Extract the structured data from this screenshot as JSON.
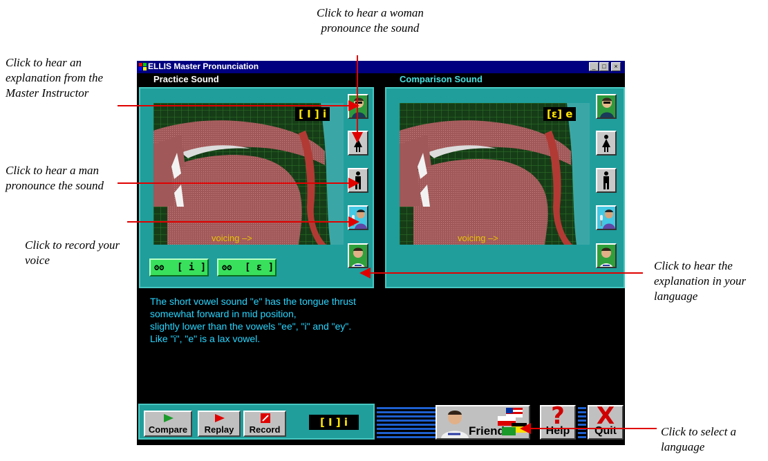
{
  "window": {
    "title": "ELLIS Master Pronunciation",
    "controls": [
      "_",
      "□",
      "×"
    ]
  },
  "practice": {
    "header": "Practice Sound",
    "phoneme": "[ I ]  i",
    "voicing": "voicing –>"
  },
  "comparison": {
    "header": "Comparison Sound",
    "phoneme": "[ε] e",
    "voicing": "voicing –>"
  },
  "compare_buttons": [
    {
      "label": "[ i ]"
    },
    {
      "label": "[ ε ]"
    }
  ],
  "side_buttons": [
    "instructor-icon",
    "woman-icon",
    "man-icon",
    "record-voice-icon",
    "native-language-icon"
  ],
  "explanation": {
    "lines": [
      "The short vowel sound \"e\" has the tongue thrust",
      "somewhat forward in mid position,",
      "slightly lower than the vowels \"ee\", \"i\" and \"ey\".",
      "Like \"i\", \"e\" is a lax vowel."
    ]
  },
  "toolbar": {
    "compare_label": "Compare",
    "replay_label": "Replay",
    "record_label": "Record",
    "current_sound": "[ I ]  i",
    "friend_label": "Friend",
    "help_label": "Help",
    "quit_label": "Quit"
  },
  "callouts": {
    "woman": [
      "Click to hear a woman",
      "pronounce the sound"
    ],
    "instructor": [
      "Click to hear an",
      "explanation from the",
      "Master Instructor"
    ],
    "man": [
      "Click to hear a man",
      "pronounce the sound"
    ],
    "record": [
      "Click to record your",
      "voice"
    ],
    "language_expl": [
      "Click to hear the",
      "explanation in your",
      "language"
    ],
    "select_language": [
      "Click to select a",
      "language"
    ]
  },
  "colors": {
    "panel": "#1f9e9c",
    "explanation_text": "#28d6ff",
    "phoneme_text": "#ffe600",
    "arrow": "#e00000"
  }
}
